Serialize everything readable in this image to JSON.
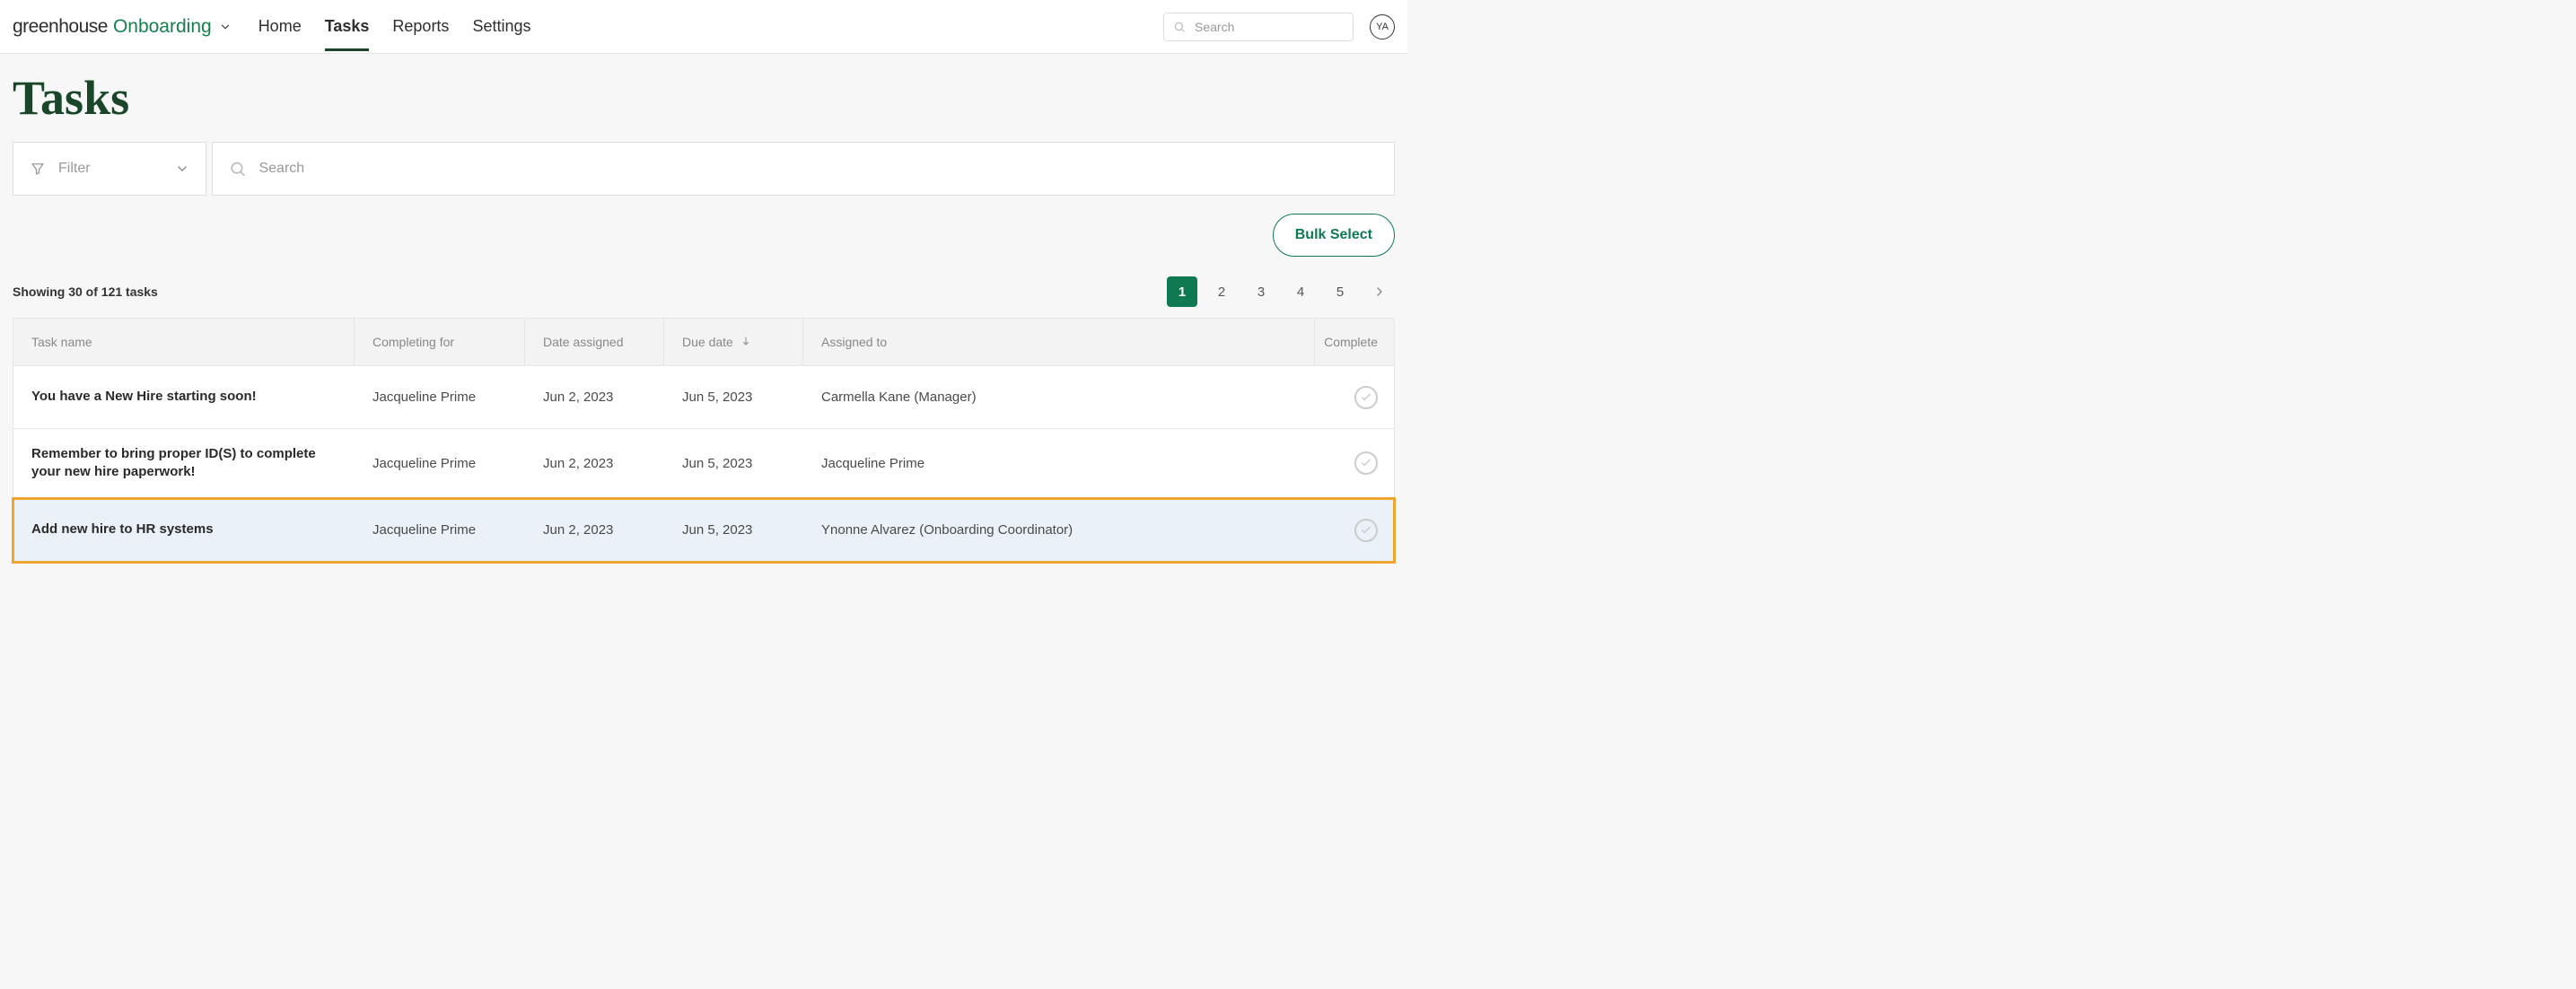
{
  "brand": {
    "name": "greenhouse",
    "product": "Onboarding"
  },
  "nav": {
    "items": [
      {
        "label": "Home"
      },
      {
        "label": "Tasks"
      },
      {
        "label": "Reports"
      },
      {
        "label": "Settings"
      }
    ],
    "active_index": 1
  },
  "top_search": {
    "placeholder": "Search"
  },
  "avatar": {
    "initials": "YA"
  },
  "page": {
    "title": "Tasks",
    "filter_label": "Filter",
    "search_placeholder": "Search",
    "bulk_select_label": "Bulk Select",
    "showing_text": "Showing 30 of 121 tasks"
  },
  "pagination": {
    "pages": [
      "1",
      "2",
      "3",
      "4",
      "5"
    ],
    "active_index": 0
  },
  "table": {
    "headers": {
      "task_name": "Task name",
      "completing_for": "Completing for",
      "date_assigned": "Date assigned",
      "due_date": "Due date",
      "assigned_to": "Assigned to",
      "complete": "Complete"
    },
    "rows": [
      {
        "task_name": "You have a New Hire starting soon!",
        "completing_for": "Jacqueline Prime",
        "date_assigned": "Jun 2, 2023",
        "due_date": "Jun 5, 2023",
        "assigned_to": "Carmella Kane (Manager)",
        "highlighted": false
      },
      {
        "task_name": "Remember to bring proper ID(S) to complete your new hire paperwork!",
        "completing_for": "Jacqueline Prime",
        "date_assigned": "Jun 2, 2023",
        "due_date": "Jun 5, 2023",
        "assigned_to": "Jacqueline Prime",
        "highlighted": false
      },
      {
        "task_name": "Add new hire to HR systems",
        "completing_for": "Jacqueline Prime",
        "date_assigned": "Jun 2, 2023",
        "due_date": "Jun 5, 2023",
        "assigned_to": "Ynonne Alvarez (Onboarding Coordinator)",
        "highlighted": true
      }
    ]
  }
}
